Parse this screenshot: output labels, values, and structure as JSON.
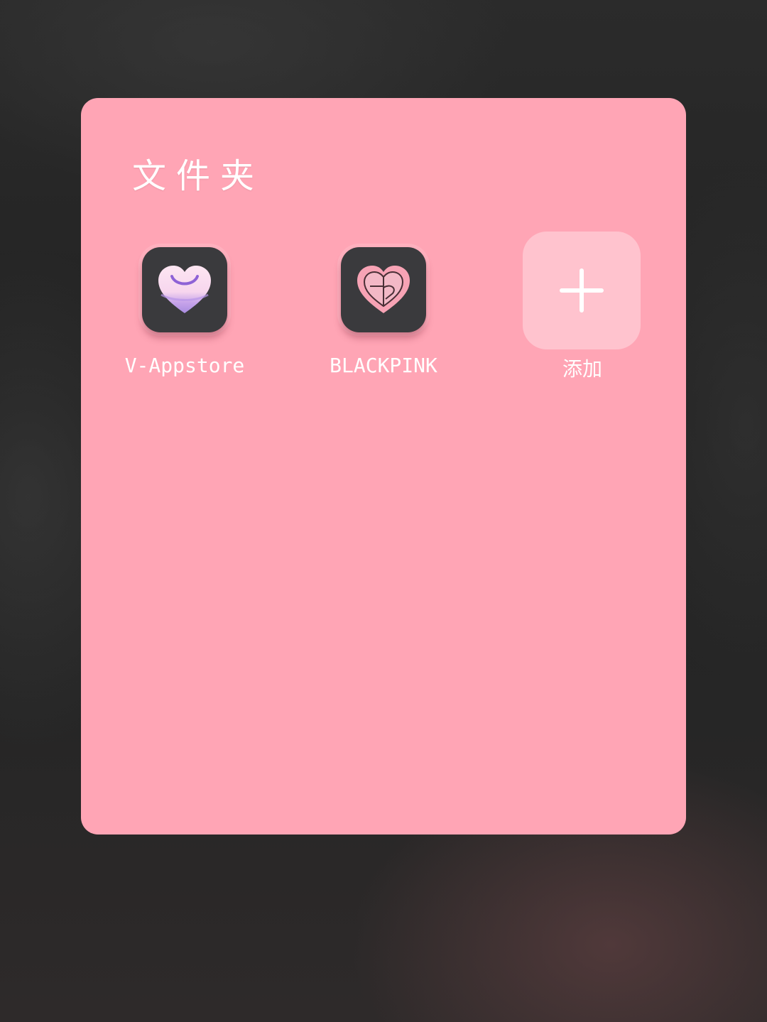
{
  "folder": {
    "title": "文件夹",
    "apps": [
      {
        "label": "V-Appstore",
        "icon": "heart-bag-icon"
      },
      {
        "label": "BLACKPINK",
        "icon": "heart-logo-icon"
      }
    ],
    "add": {
      "label": "添加",
      "icon": "plus-icon"
    }
  },
  "colors": {
    "panel": "#ffa5b5",
    "add_tile": "#ffc3ce",
    "icon_background": "#3a3a3d",
    "text": "#ffffff"
  }
}
